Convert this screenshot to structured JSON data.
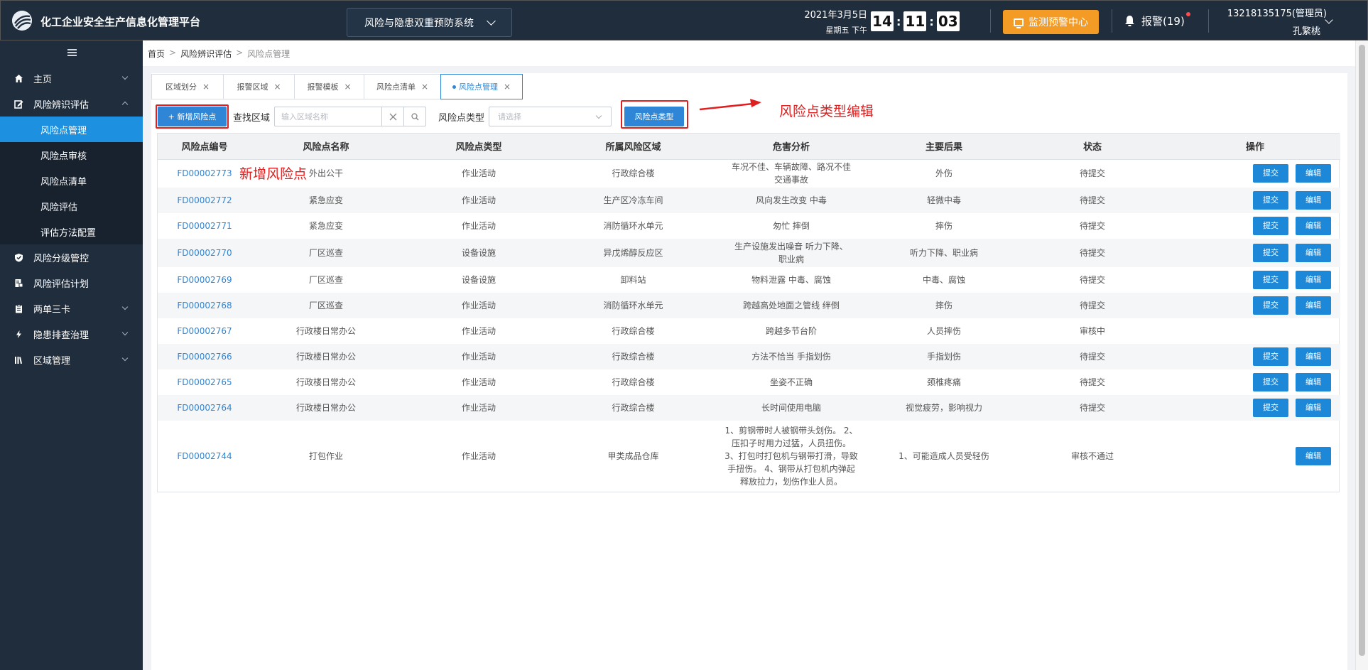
{
  "header": {
    "app_title": "化工企业安全生产信息化管理平台",
    "system_select": "风险与隐患双重预防系统",
    "date": "2021年3月5日",
    "weekday": "星期五 下午",
    "clock": {
      "h": "14",
      "m": "11",
      "s": "03"
    },
    "monitor_button": "监测预警中心",
    "alarm": "报警(19)",
    "user_account": "13218135175(管理员)",
    "user_name": "孔繁桃"
  },
  "sidebar": {
    "items": [
      {
        "label": "主页"
      },
      {
        "label": "风险辨识评估"
      },
      {
        "label": "风险点管理"
      },
      {
        "label": "风险点审核"
      },
      {
        "label": "风险点清单"
      },
      {
        "label": "风险评估"
      },
      {
        "label": "评估方法配置"
      },
      {
        "label": "风险分级管控"
      },
      {
        "label": "风险评估计划"
      },
      {
        "label": "两单三卡"
      },
      {
        "label": "隐患排查治理"
      },
      {
        "label": "区域管理"
      }
    ]
  },
  "breadcrumb": [
    "首页",
    "风险辨识评估",
    "风险点管理"
  ],
  "tabs": [
    "区域划分",
    "报警区域",
    "报警模板",
    "风险点清单",
    "风险点管理"
  ],
  "toolbar": {
    "add_button": "+ 新增风险点",
    "search_label": "查找区域",
    "search_placeholder": "输入区域名称",
    "type_label": "风险点类型",
    "type_placeholder": "请选择",
    "type_button": "风险点类型"
  },
  "annotations": {
    "add_note": "新增风险点",
    "type_note": "风险点类型编辑"
  },
  "table": {
    "headers": [
      "风险点编号",
      "风险点名称",
      "风险点类型",
      "所属风险区域",
      "危害分析",
      "主要后果",
      "状态",
      "操作"
    ],
    "submit_label": "提交",
    "edit_label": "编辑",
    "rows": [
      {
        "code": "FD00002773",
        "name": "外出公干",
        "type": "作业活动",
        "area": "行政综合楼",
        "hazard": "车况不佳、车辆故障、路况不佳 交通事故",
        "result": "外伤",
        "status": "待提交"
      },
      {
        "code": "FD00002772",
        "name": "紧急应变",
        "type": "作业活动",
        "area": "生产区冷冻车间",
        "hazard": "风向发生改变 中毒",
        "result": "轻微中毒",
        "status": "待提交"
      },
      {
        "code": "FD00002771",
        "name": "紧急应变",
        "type": "作业活动",
        "area": "消防循环水单元",
        "hazard": "匆忙 摔倒",
        "result": "摔伤",
        "status": "待提交"
      },
      {
        "code": "FD00002770",
        "name": "厂区巡查",
        "type": "设备设施",
        "area": "异戊烯醇反应区",
        "hazard": "生产设施发出噪音 听力下降、职业病",
        "result": "听力下降、职业病",
        "status": "待提交"
      },
      {
        "code": "FD00002769",
        "name": "厂区巡查",
        "type": "设备设施",
        "area": "卸料站",
        "hazard": "物料泄露 中毒、腐蚀",
        "result": "中毒、腐蚀",
        "status": "待提交"
      },
      {
        "code": "FD00002768",
        "name": "厂区巡查",
        "type": "作业活动",
        "area": "消防循环水单元",
        "hazard": "跨越高处地面之管线 绊倒",
        "result": "摔伤",
        "status": "待提交"
      },
      {
        "code": "FD00002767",
        "name": "行政楼日常办公",
        "type": "作业活动",
        "area": "行政综合楼",
        "hazard": "跨越多节台阶",
        "result": "人员摔伤",
        "status": "审核中"
      },
      {
        "code": "FD00002766",
        "name": "行政楼日常办公",
        "type": "作业活动",
        "area": "行政综合楼",
        "hazard": "方法不恰当 手指划伤",
        "result": "手指划伤",
        "status": "待提交"
      },
      {
        "code": "FD00002765",
        "name": "行政楼日常办公",
        "type": "作业活动",
        "area": "行政综合楼",
        "hazard": "坐姿不正确",
        "result": "颈椎疼痛",
        "status": "待提交"
      },
      {
        "code": "FD00002764",
        "name": "行政楼日常办公",
        "type": "作业活动",
        "area": "行政综合楼",
        "hazard": "长时间使用电脑",
        "result": "视觉疲劳，影响视力",
        "status": "待提交"
      },
      {
        "code": "FD00002744",
        "name": "打包作业",
        "type": "作业活动",
        "area": "甲类成品仓库",
        "hazard": "1、剪钢带时人被钢带头划伤。 2、压扣子时用力过猛，人员扭伤。 3、打包时打包机与钢带打滑，导致手扭伤。 4、钢带从打包机内弹起释放拉力，划伤作业人员。",
        "result": "1、可能造成人员受轻伤",
        "status": "审核不通过"
      }
    ]
  }
}
